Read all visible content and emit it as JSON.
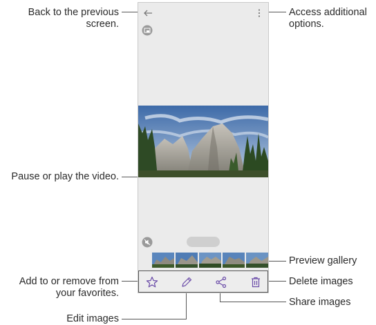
{
  "callouts": {
    "back": "Back to the previous screen.",
    "more": "Access additional options.",
    "play": "Pause or play the video.",
    "preview": "Preview gallery",
    "favorites": "Add to or remove from your favorites.",
    "delete": "Delete images",
    "share": "Share images",
    "edit": "Edit images"
  },
  "colors": {
    "accent": "#6a4ba8",
    "screen_bg": "#ebebeb",
    "leader_line": "#555555"
  },
  "icons": [
    "back-arrow-icon",
    "more-options-icon",
    "screen-share-icon",
    "mute-icon",
    "star-icon",
    "pencil-icon",
    "share-icon",
    "trash-icon"
  ]
}
